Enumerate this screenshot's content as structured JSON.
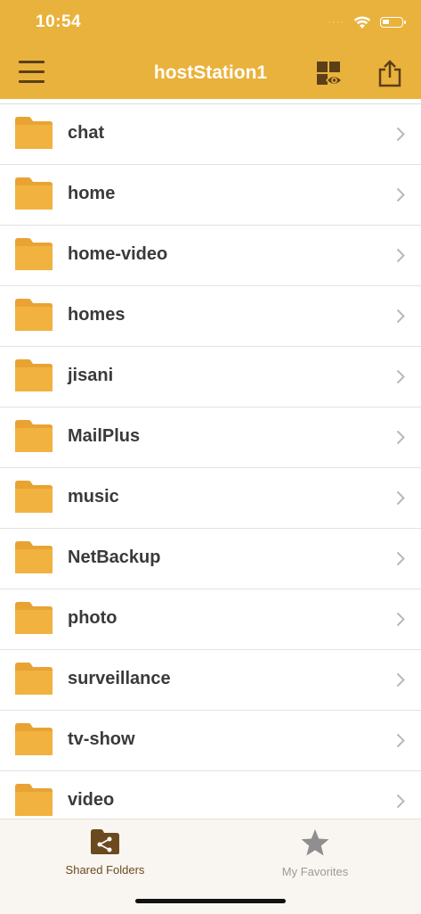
{
  "status_bar": {
    "time": "10:54",
    "signal": "····"
  },
  "header": {
    "title": "hostStation1"
  },
  "folders": [
    {
      "name": "chat"
    },
    {
      "name": "home"
    },
    {
      "name": "home-video"
    },
    {
      "name": "homes"
    },
    {
      "name": "jisani"
    },
    {
      "name": "MailPlus"
    },
    {
      "name": "music"
    },
    {
      "name": "NetBackup"
    },
    {
      "name": "photo"
    },
    {
      "name": "surveillance"
    },
    {
      "name": "tv-show"
    },
    {
      "name": "video"
    }
  ],
  "tabbar": {
    "shared_label": "Shared Folders",
    "favorites_label": "My Favorites"
  },
  "colors": {
    "header_bg": "#E9B23C",
    "folder": "#F1B23F",
    "folder_tab": "#E8A333",
    "active_tab": "#6b4a1f",
    "inactive_tab": "#9a9a9a"
  },
  "icons": {
    "menu": "hamburger-icon",
    "view": "view-mode-icon",
    "share": "share-icon",
    "folder": "folder-icon",
    "chevron": "chevron-right-icon",
    "shared_folders": "shared-folder-icon",
    "favorites": "star-icon"
  }
}
